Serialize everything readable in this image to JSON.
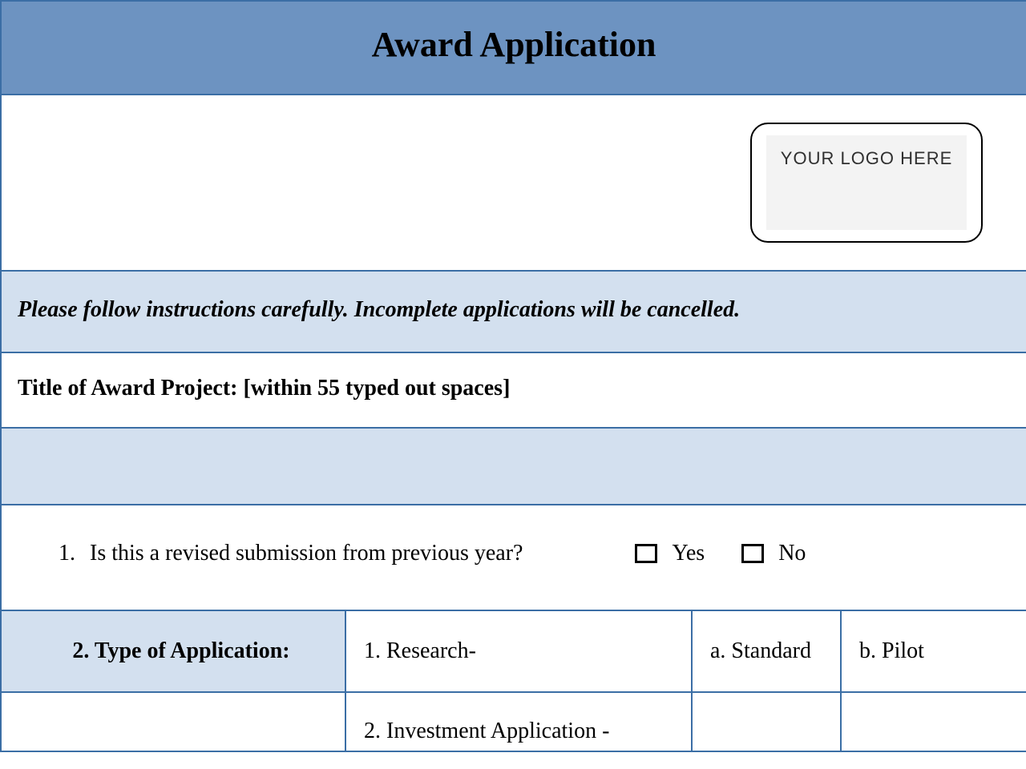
{
  "header": {
    "title": "Award Application"
  },
  "logo": {
    "placeholder": "YOUR LOGO HERE"
  },
  "instructions": {
    "text": "Please follow instructions carefully. Incomplete applications will be cancelled."
  },
  "title_field": {
    "label": "Title of Award Project: [within 55 typed out spaces]"
  },
  "question1": {
    "number": "1.",
    "text": "Is this a revised submission from previous year?",
    "yes_label": "Yes",
    "no_label": "No"
  },
  "question2": {
    "label": "2. Type of Application:",
    "option1": "1. Research-",
    "option1a": "a. Standard",
    "option1b": "b. Pilot",
    "option2": "2. Investment Application -"
  }
}
